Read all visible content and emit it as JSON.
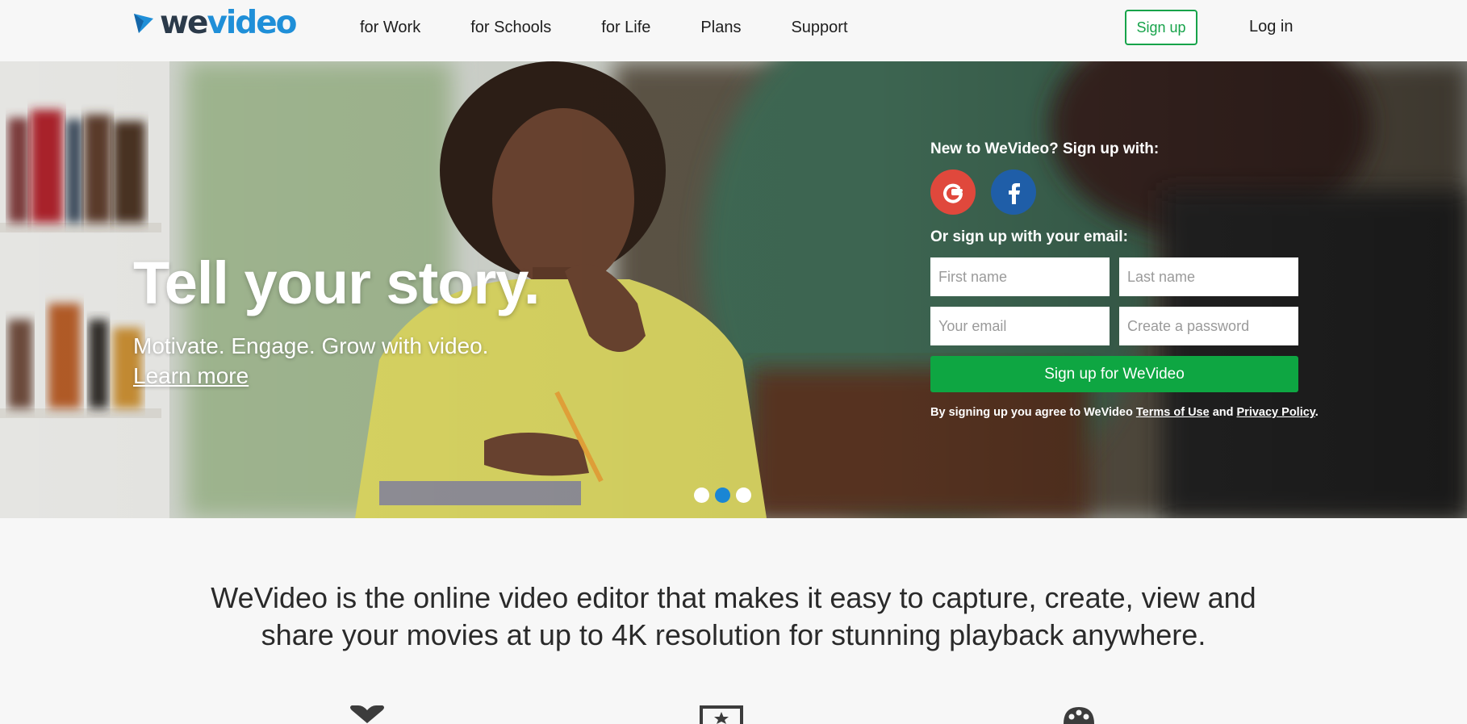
{
  "brand": {
    "logo_we": "we",
    "logo_video": "video",
    "accent": "#1f8fd8",
    "green": "#0ea642"
  },
  "nav": {
    "items": [
      "for Work",
      "for Schools",
      "for Life",
      "Plans",
      "Support"
    ],
    "signup": "Sign up",
    "login": "Log in"
  },
  "hero": {
    "title": "Tell your story.",
    "subtitle": "Motivate. Engage. Grow with video.",
    "learn_more": "Learn more",
    "slides": 3,
    "active_slide": 2
  },
  "signup_panel": {
    "title": "New to WeVideo? Sign up with:",
    "social": [
      "google-icon",
      "facebook-icon"
    ],
    "email_title": "Or sign up with your email:",
    "first_name_placeholder": "First name",
    "last_name_placeholder": "Last name",
    "email_placeholder": "Your email",
    "password_placeholder": "Create a password",
    "submit": "Sign up for WeVideo",
    "legal_prefix": "By signing up you agree to WeVideo ",
    "terms": "Terms of Use",
    "legal_and": " and ",
    "privacy": "Privacy Policy",
    "legal_suffix": "."
  },
  "tagline": {
    "line1": "WeVideo is the online video editor that makes it easy to capture, create, view and",
    "line2": "share your movies at up to 4K resolution for stunning playback anywhere."
  },
  "features": [
    "heart-icon",
    "star-screen-icon",
    "palette-icon"
  ]
}
